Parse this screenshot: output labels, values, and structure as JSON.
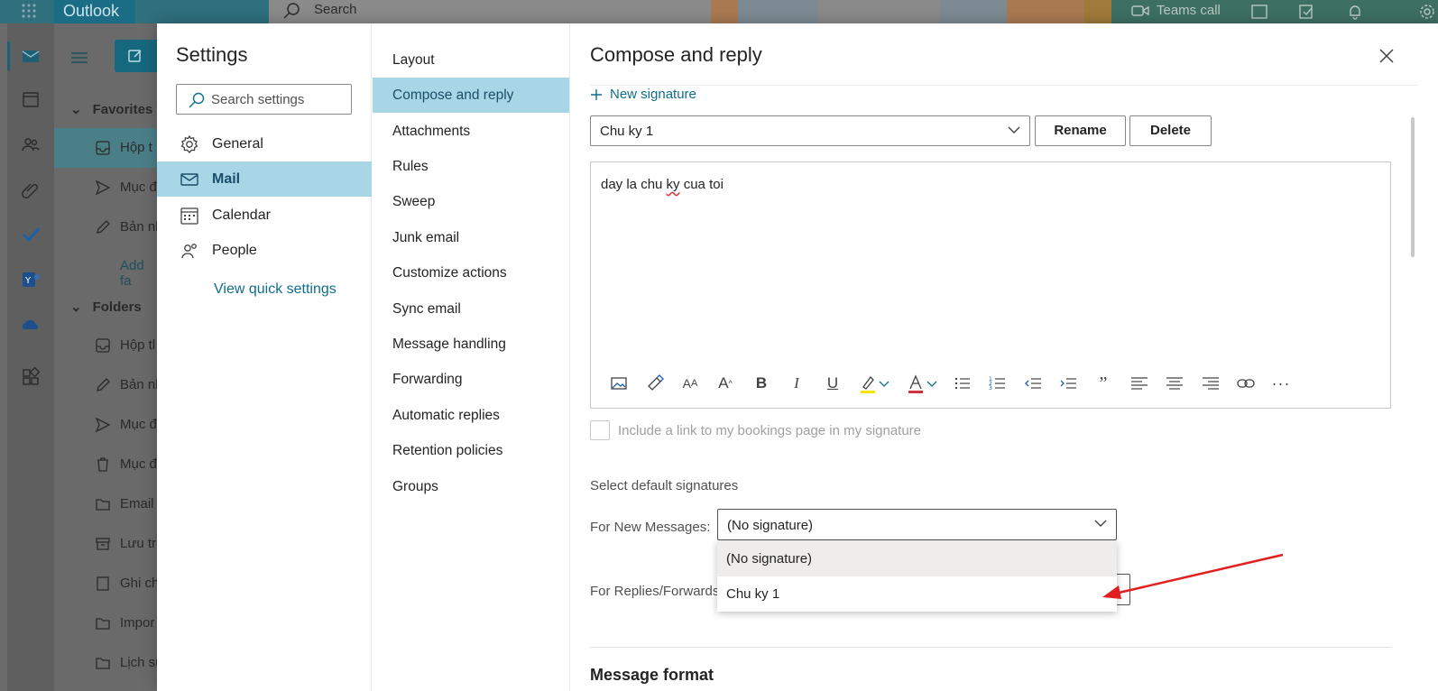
{
  "background": {
    "app_name": "Outlook",
    "search_placeholder": "Search",
    "teams_call": "Teams call",
    "nav": {
      "favorites": "Favorites",
      "folders": "Folders",
      "add_favorite": "Add fa",
      "favorite_items": [
        "Hộp t",
        "Mục đ",
        "Bản nl"
      ],
      "folder_items": [
        "Hộp tl",
        "Bản nl",
        "Mục đ",
        "Mục đ",
        "Email",
        "Lưu tr",
        "Ghi ch",
        "Impor",
        "Lịch sử"
      ]
    }
  },
  "settings": {
    "title": "Settings",
    "search_placeholder": "Search settings",
    "categories": [
      {
        "label": "General",
        "icon": "gear-icon"
      },
      {
        "label": "Mail",
        "icon": "mail-icon"
      },
      {
        "label": "Calendar",
        "icon": "calendar-icon"
      },
      {
        "label": "People",
        "icon": "people-icon"
      }
    ],
    "selected_category": "Mail",
    "quick_settings_link": "View quick settings",
    "subcategories": [
      "Layout",
      "Compose and reply",
      "Attachments",
      "Rules",
      "Sweep",
      "Junk email",
      "Customize actions",
      "Sync email",
      "Message handling",
      "Forwarding",
      "Automatic replies",
      "Retention policies",
      "Groups"
    ],
    "selected_subcategory": "Compose and reply"
  },
  "pane": {
    "title": "Compose and reply",
    "new_signature": "New signature",
    "signature_select_value": "Chu ky 1",
    "rename_label": "Rename",
    "delete_label": "Delete",
    "signature_text_before": "day la chu ",
    "signature_text_misspelled": "ky",
    "signature_text_after": " cua toi",
    "toolbar_icons": [
      "insert-image-icon",
      "format-painter-icon",
      "font-icon",
      "font-size-icon",
      "bold-icon",
      "italic-icon",
      "underline-icon",
      "highlight-icon",
      "font-color-icon",
      "bullets-icon",
      "numbering-icon",
      "decrease-indent-icon",
      "increase-indent-icon",
      "quote-icon",
      "align-left-icon",
      "align-center-icon",
      "align-right-icon",
      "link-icon",
      "more-icon"
    ],
    "bookings_checkbox_label": "Include a link to my bookings page in my signature",
    "default_signatures_title": "Select default signatures",
    "for_new_messages_label": "For New Messages:",
    "for_new_messages_value": "(No signature)",
    "for_replies_label": "For Replies/Forwards",
    "dropdown_options": [
      "(No signature)",
      "Chu ky 1"
    ],
    "highlighted_option": "(No signature)",
    "message_format_title": "Message format"
  },
  "colors": {
    "accent": "#0e6e8a",
    "selected_bg": "#a9d6e6",
    "annotation_arrow": "#e02020"
  }
}
